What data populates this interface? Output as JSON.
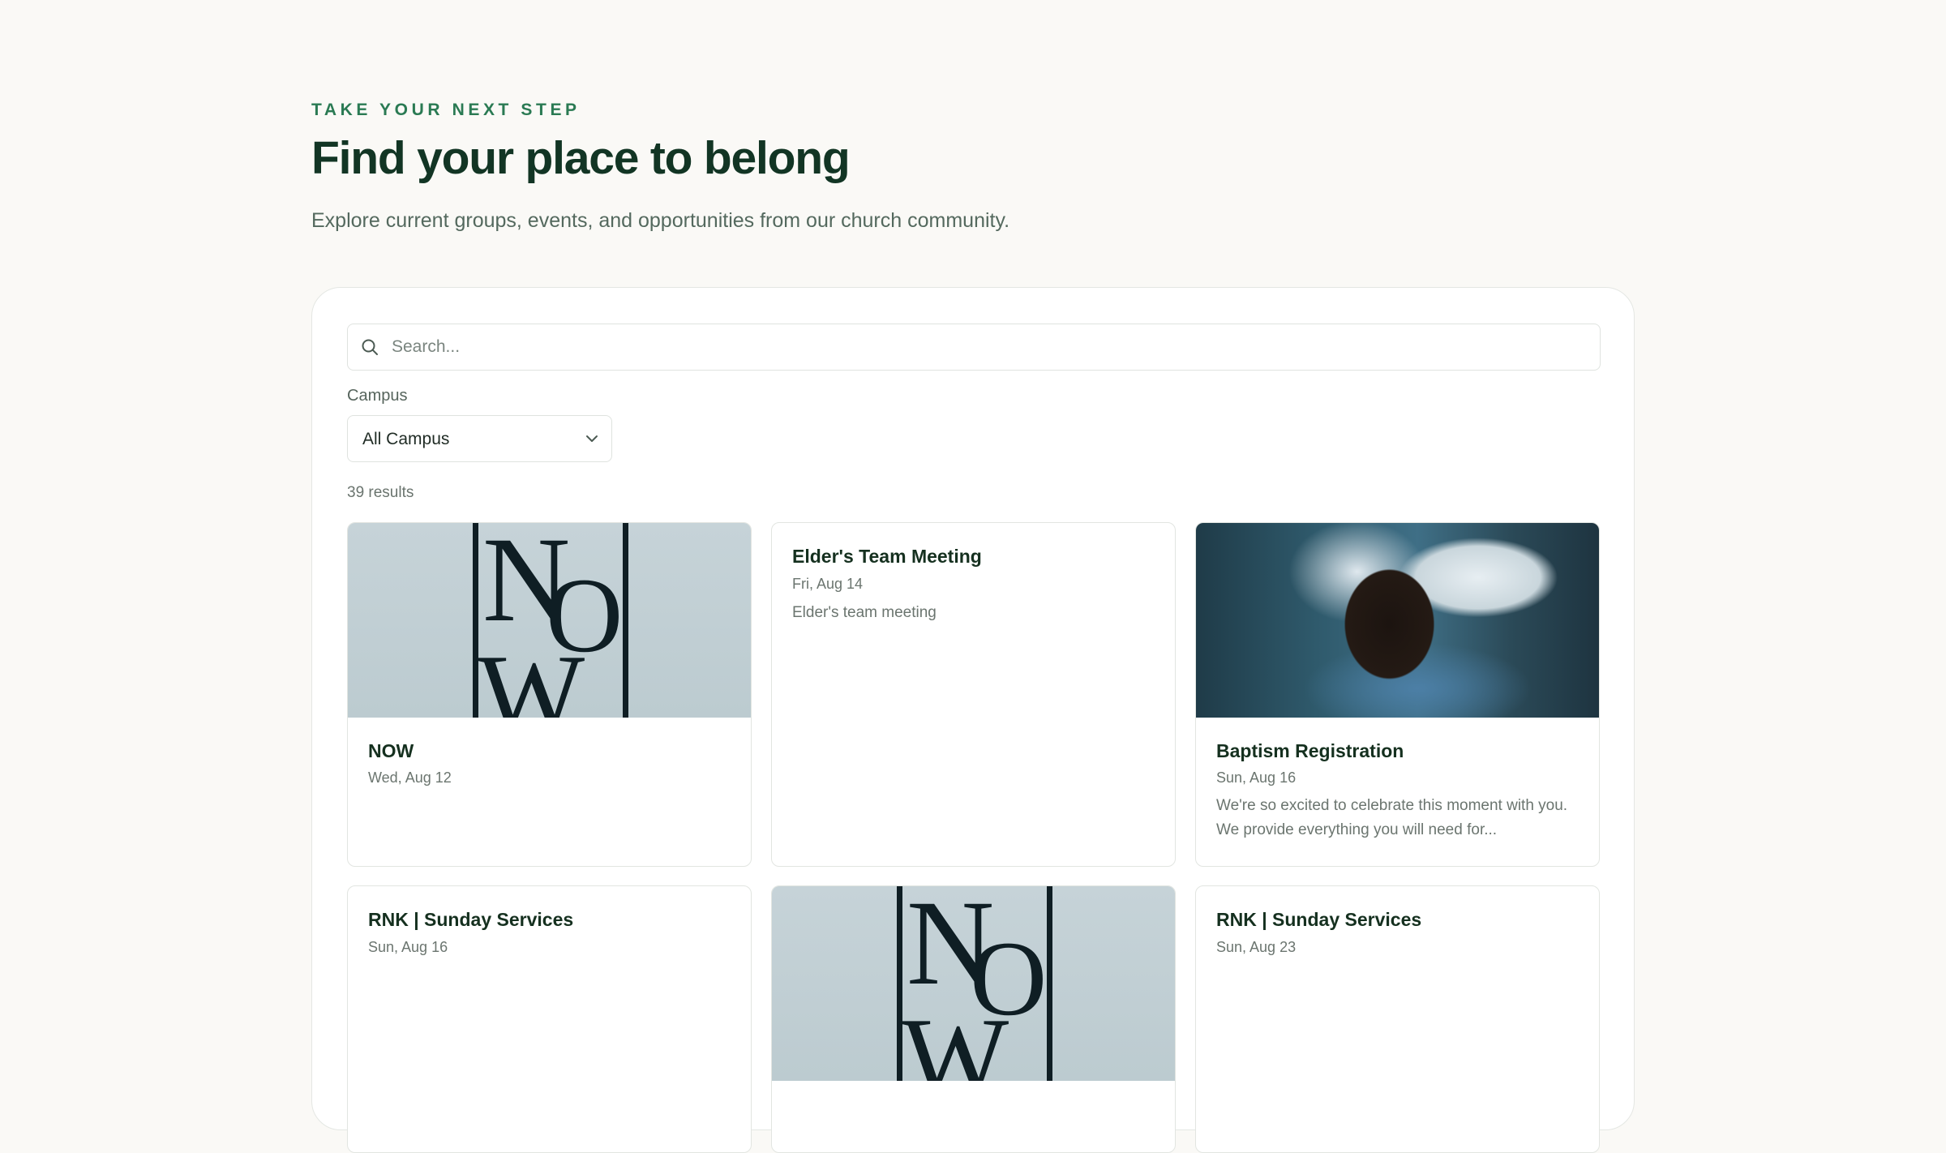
{
  "header": {
    "eyebrow": "TAKE YOUR NEXT STEP",
    "title": "Find your place to belong",
    "subtitle": "Explore current groups, events, and opportunities from our church community."
  },
  "search": {
    "placeholder": "Search...",
    "value": ""
  },
  "filters": {
    "campus_label": "Campus",
    "campus_selected": "All Campus"
  },
  "results": {
    "count_text": "39 results"
  },
  "cards": [
    {
      "image": "now-poster",
      "title": "NOW",
      "date": "Wed, Aug 12",
      "description": ""
    },
    {
      "image": "",
      "title": "Elder's Team Meeting",
      "date": "Fri, Aug 14",
      "description": "Elder's team meeting"
    },
    {
      "image": "baptism-photo",
      "title": "Baptism Registration",
      "date": "Sun, Aug 16",
      "description": "We're so excited to celebrate this moment with you. We provide everything you will need for..."
    },
    {
      "image": "",
      "title": "RNK | Sunday Services",
      "date": "Sun, Aug 16",
      "description": ""
    },
    {
      "image": "now-poster",
      "title": "",
      "date": "",
      "description": ""
    },
    {
      "image": "",
      "title": "RNK | Sunday Services",
      "date": "Sun, Aug 23",
      "description": ""
    }
  ],
  "now_poster": {
    "letters": [
      "N",
      "O",
      "W"
    ]
  },
  "colors": {
    "accent": "#2a7a53",
    "heading": "#123524",
    "background": "#faf9f6",
    "card_border": "#e2e5e1",
    "poster_bg": "#c6d3d8"
  },
  "icons": {
    "search": "search-icon",
    "dropdown": "chevron-down-icon"
  }
}
